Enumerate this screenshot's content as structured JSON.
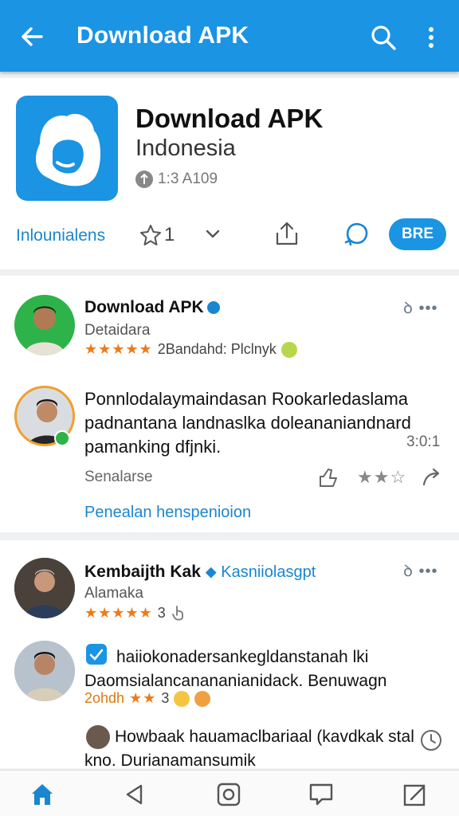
{
  "appbar": {
    "title": "Download APK",
    "back_icon": "arrow-left-icon",
    "search_icon": "search-icon",
    "more_icon": "more-vertical-icon",
    "color": "#1a94e3"
  },
  "app": {
    "name": "Download APK",
    "subtitle": "Indonesia",
    "meta": "1:3 A109",
    "action_label": "Inlounialens",
    "rating_count": "1",
    "button_label": "BRE"
  },
  "review1": {
    "name": "Download APK",
    "subtitle": "Detaidara",
    "stars": "★★★★★",
    "rating_text": "2Bandahd: Plclnyk",
    "body": "Ponnlodalaymaindasan Rookarledaslama padnantana landnaslka doleananiandnard pamanking dfjnki.",
    "time": "3:0:1",
    "footer_label": "Senalarse",
    "stars_small": "★★☆",
    "link": "Penealan henspenioion",
    "mini_icon": "ae-icon"
  },
  "review2": {
    "name": "Kembaijth Kak",
    "tag": "Kasniiolasgpt",
    "subtitle": "Alamaka",
    "stars": "★★★★★",
    "rating_num": "3",
    "mini_icon": "ae-icon",
    "reply1": "haiiokonadersankegldanstanah lki Daomsialancanananianidack. Benuwagn",
    "reply1_prefix": "2ohdh",
    "reply1_stars": "★★",
    "reply1_num": "3",
    "reply2": "Howbaak hauamaclbariaal (kavdkak stal kno. Durianamansumik"
  },
  "accent": "#1a94e3",
  "star_color": "#f07a17"
}
